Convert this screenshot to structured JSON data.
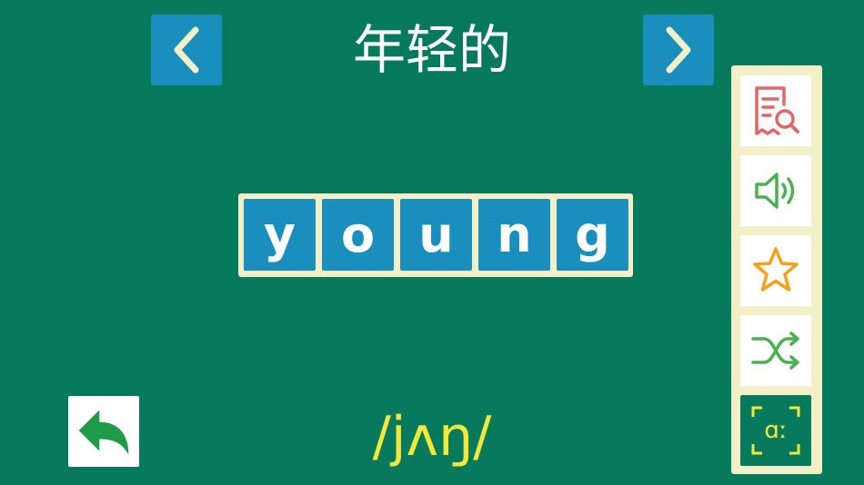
{
  "header": {
    "title": "年轻的"
  },
  "word": {
    "letters": [
      "y",
      "o",
      "u",
      "n",
      "g"
    ]
  },
  "phonetic": "/jʌŋ/",
  "icons": {
    "prev": "chevron-left-icon",
    "next": "chevron-right-icon",
    "back": "back-arrow-icon",
    "lookup": "document-search-icon",
    "sound": "speaker-icon",
    "favorite": "star-icon",
    "shuffle": "shuffle-icon",
    "phonetic_toggle": "phonetic-symbol-icon"
  },
  "phonetic_toggle_label": "ɑː",
  "colors": {
    "background": "#077a5e",
    "tile": "#1a8fbe",
    "panel": "#f3efc6",
    "phonetic_text": "#f3e83a",
    "lookup_icon": "#e06767",
    "sound_icon": "#4bb04f",
    "star_icon": "#f6a11c",
    "shuffle_icon": "#4bb04f",
    "phonetic_icon": "#f3e83a"
  }
}
